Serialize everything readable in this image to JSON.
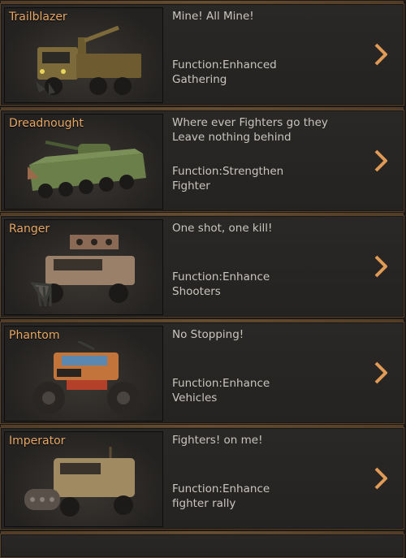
{
  "vehicles": [
    {
      "name": "Trailblazer",
      "tagline": "Mine! All Mine!",
      "function_label": "Function:Enhanced",
      "function_target": "Gathering",
      "body_color": "#7d6a3a",
      "icon": "chevron-right-icon"
    },
    {
      "name": "Dreadnought",
      "tagline": "Where ever Fighters go they Leave nothing behind",
      "function_label": "Function:Strengthen",
      "function_target": "Fighter",
      "body_color": "#6b7f4a",
      "icon": "chevron-right-icon"
    },
    {
      "name": "Ranger",
      "tagline": "One shot, one kill!",
      "function_label": "Function:Enhance",
      "function_target": "Shooters",
      "body_color": "#9a8068",
      "icon": "chevron-right-icon"
    },
    {
      "name": "Phantom",
      "tagline": "No Stopping!",
      "function_label": "Function:Enhance",
      "function_target": "Vehicles",
      "body_color": "#c2743a",
      "icon": "chevron-right-icon"
    },
    {
      "name": "Imperator",
      "tagline": "Fighters! on me!",
      "function_label": "Function:Enhance",
      "function_target": "fighter rally",
      "body_color": "#a08a62",
      "icon": "chevron-right-icon"
    }
  ],
  "colors": {
    "accent": "#e8a865",
    "arrow": "#e09a55",
    "text": "#c9c5bf"
  }
}
